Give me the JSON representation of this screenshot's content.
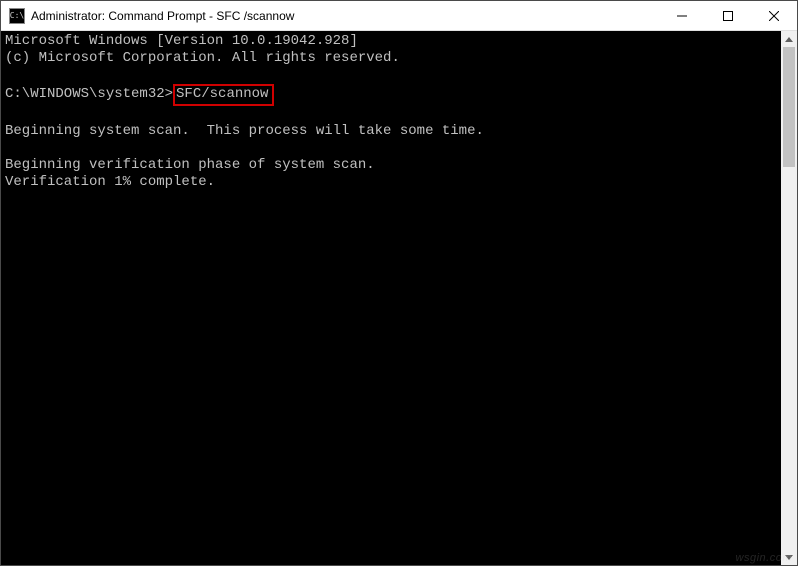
{
  "titlebar": {
    "icon_glyph": "C:\\",
    "title": "Administrator: Command Prompt - SFC /scannow"
  },
  "terminal": {
    "line1": "Microsoft Windows [Version 10.0.19042.928]",
    "line2": "(c) Microsoft Corporation. All rights reserved.",
    "blank1": "",
    "prompt": "C:\\WINDOWS\\system32>",
    "command": "SFC/scannow",
    "blank2": "",
    "scan1": "Beginning system scan.  This process will take some time.",
    "blank3": "",
    "verif1": "Beginning verification phase of system scan.",
    "verif2": "Verification 1% complete."
  },
  "watermark": "wsgin.com"
}
